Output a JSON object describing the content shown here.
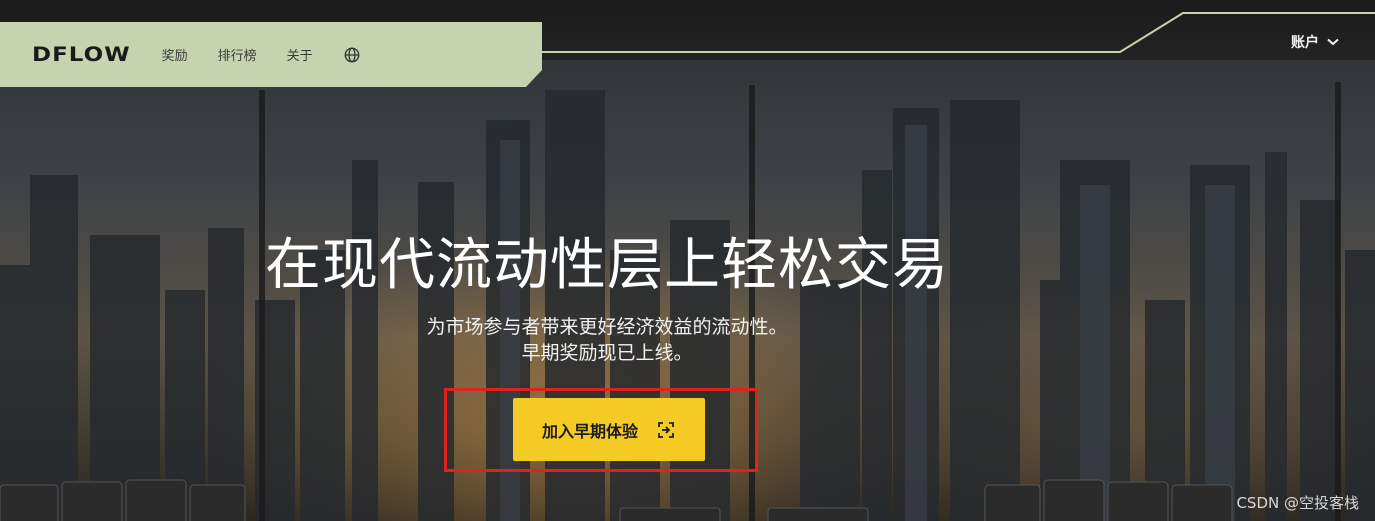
{
  "nav": {
    "logo_text": "DFLOW",
    "links": [
      "奖励",
      "排行榜",
      "关于"
    ],
    "language_icon": "globe-icon",
    "account_label": "账户",
    "account_icon": "chevron-down-icon"
  },
  "hero": {
    "title": "在现代流动性层上轻松交易",
    "subtitle_line1": "为市场参与者带来更好经济效益的流动性。",
    "subtitle_line2": "早期奖励现已上线。",
    "cta_label": "加入早期体验",
    "cta_icon": "enter-icon"
  },
  "watermark": "CSDN @空投客栈",
  "colors": {
    "nav_panel": "#c7d3ae",
    "cta_background": "#f4ca25",
    "highlight_border": "#e0211d",
    "page_background": "#1e1e1e"
  }
}
